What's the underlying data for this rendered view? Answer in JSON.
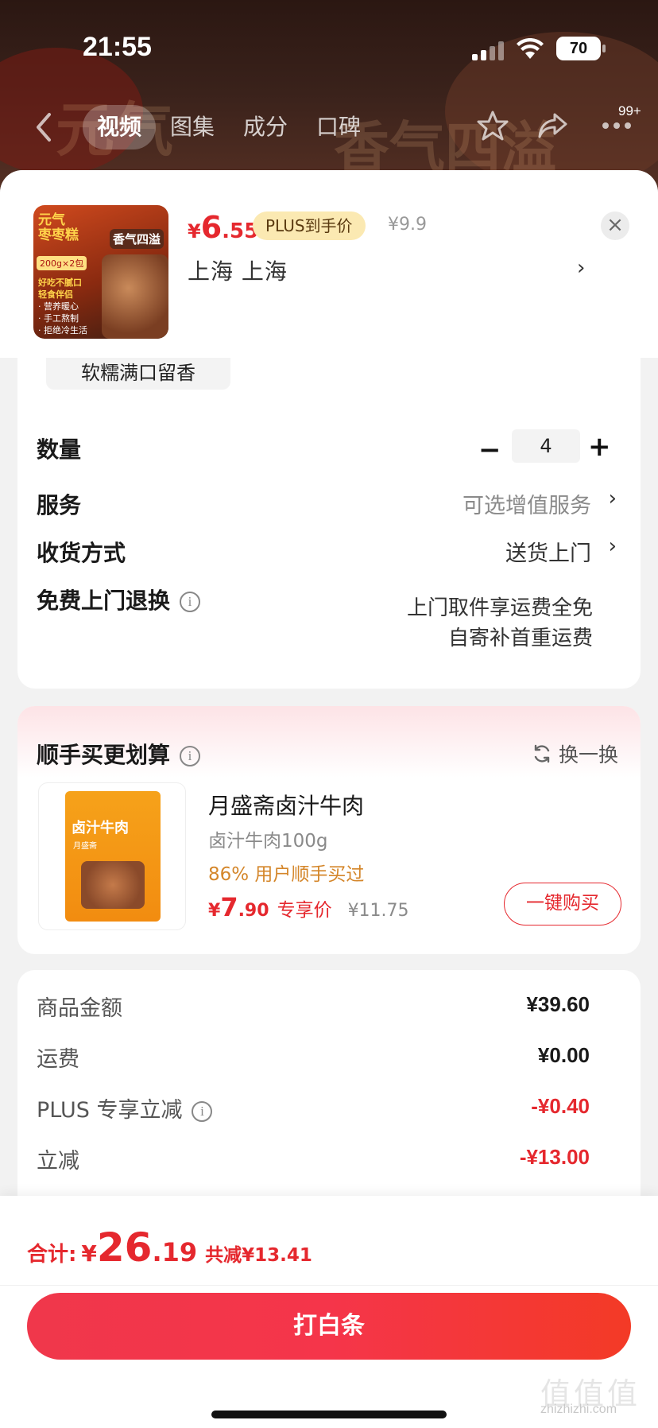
{
  "status_bar": {
    "time": "21:55",
    "battery": "70"
  },
  "nav": {
    "tabs": [
      "视频",
      "图集",
      "成分",
      "口碑"
    ],
    "active_tab_index": 0,
    "badge": "99+"
  },
  "background_text": {
    "left": "元气",
    "right": "香气四溢"
  },
  "product": {
    "thumb": {
      "title": "元气\n枣枣糕",
      "tag": "香气四溢",
      "chip": "200g×2包",
      "bullets": [
        "好吃不腻口",
        "轻食伴侣",
        "· 营养暖心",
        "· 手工熬制",
        "· 拒绝冷生活"
      ]
    },
    "price_currency": "¥",
    "price_int": "6",
    "price_dec": ".55",
    "plus_badge": "PLUS到手价",
    "original_price": "¥9.9",
    "address": "上海  上海"
  },
  "options": {
    "flavor_chip": "软糯满口留香",
    "quantity_label": "数量",
    "quantity_value": "4",
    "service_label": "服务",
    "service_value": "可选增值服务",
    "delivery_label": "收货方式",
    "delivery_value": "送货上门",
    "return_label": "免费上门退换",
    "return_line1": "上门取件享运费全免",
    "return_line2": "自寄补首重运费"
  },
  "bundle": {
    "title": "顺手买更划算",
    "swap_label": "换一换",
    "product_name": "月盛斋卤汁牛肉",
    "spec": "卤汁牛肉100g",
    "bought_text": "86% 用户顺手买过",
    "price_currency": "¥",
    "price_int": "7",
    "price_dec": ".90",
    "price_tag": "专享价",
    "original_price": "¥11.75",
    "buy_button": "一键购买",
    "pkg_title": "卤汁牛肉",
    "pkg_sub": "月盛斋"
  },
  "summary": {
    "rows": [
      {
        "label": "商品金额",
        "value": "¥39.60"
      },
      {
        "label": "运费",
        "value": "¥0.00"
      },
      {
        "label": "PLUS 专享立减",
        "value": "-¥0.40"
      },
      {
        "label": "立减",
        "value": "-¥13.00"
      }
    ]
  },
  "footer": {
    "total_label": "合计:",
    "total_currency": "¥",
    "total_int": "26",
    "total_dec": ".19",
    "total_saved": "共减¥13.41",
    "pay_button": "打白条",
    "watermark": "zhizhizhi.com"
  },
  "colors": {
    "accent_red": "#e5282e",
    "plus_gold": "#fbe9b2",
    "bought_orange": "#d4862a"
  }
}
